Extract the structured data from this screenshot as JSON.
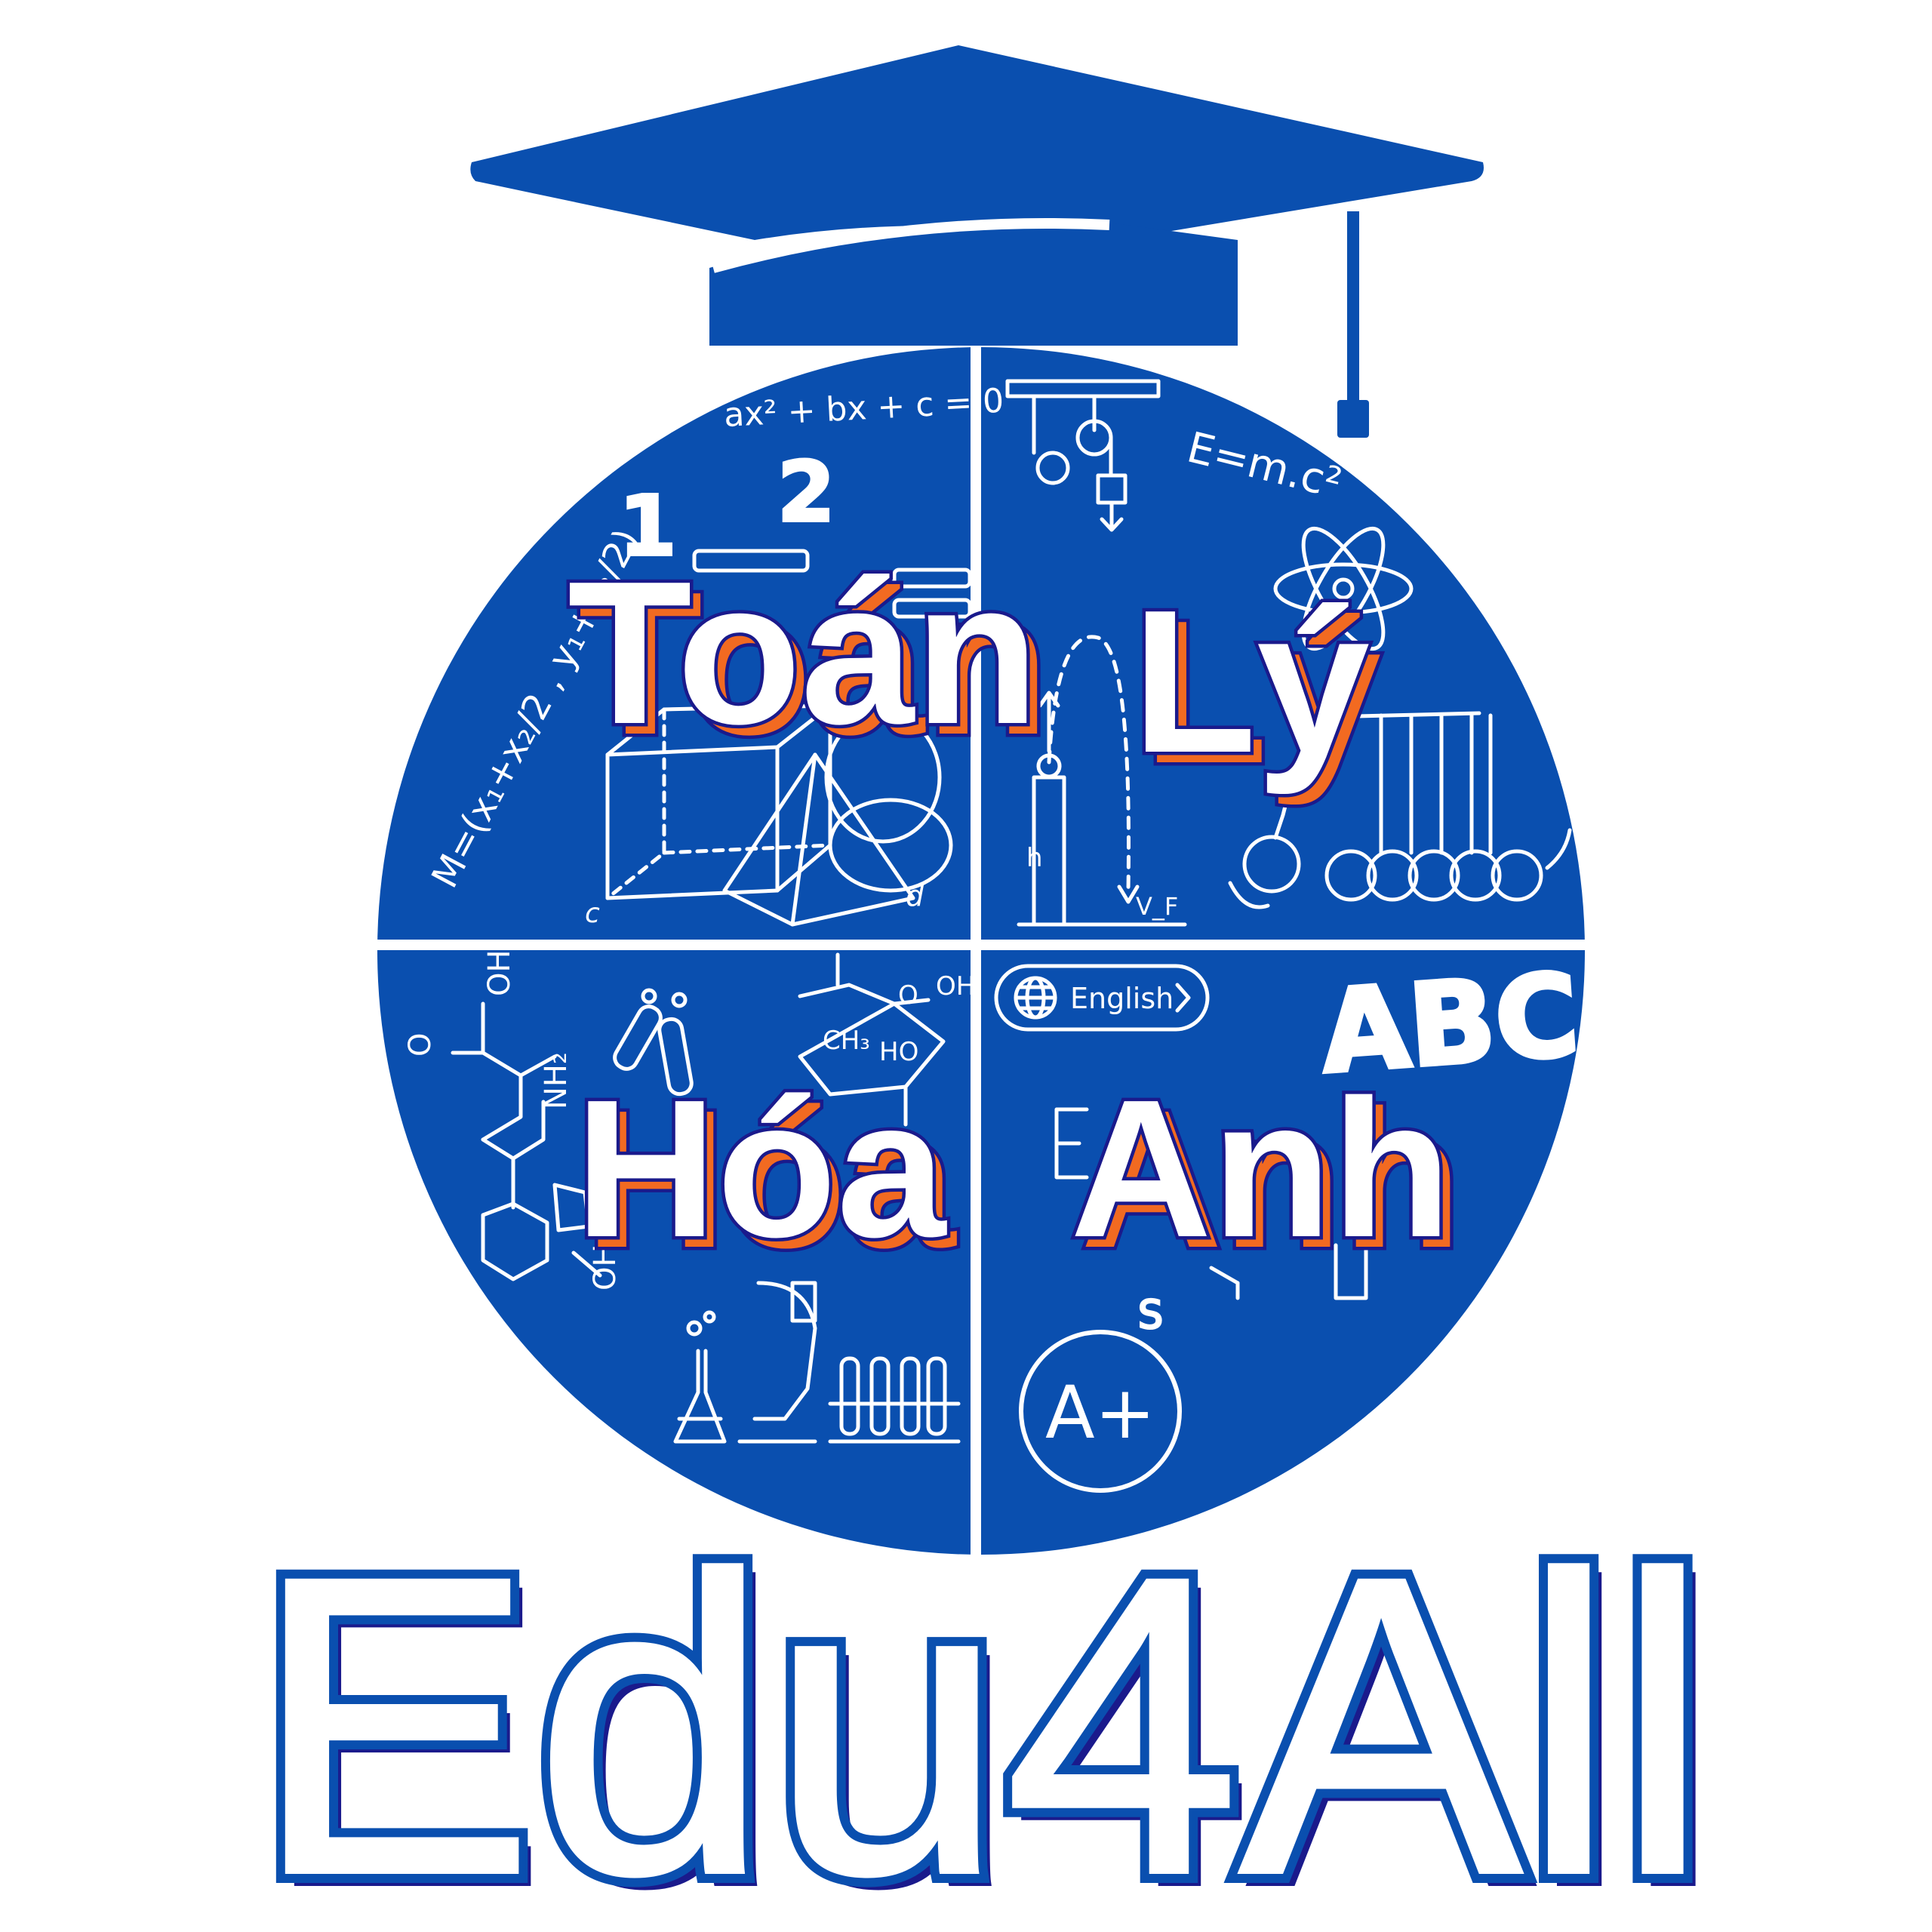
{
  "colors": {
    "brand_blue": "#0a4faf",
    "outline_navy": "#1a1a8c",
    "accent_orange": "#f26a21",
    "background": "#ffffff",
    "doodle_white": "#ffffff"
  },
  "icons": [
    "graduation-cap-icon",
    "globe-icon",
    "chevron-right-icon"
  ],
  "quadrants": {
    "math": {
      "title": "Toán",
      "formula_quadratic": "ax² + bx + c = 0",
      "formula_midpoint": "M=(x₁+x₂/2 , y₁+y₂/2)",
      "digit_one": "1",
      "digit_two": "2",
      "label_c": "c",
      "label_d": "d"
    },
    "physics": {
      "title": "Lý",
      "formula_energy": "E=m.c²",
      "label_h": "h",
      "label_vf": "V_F"
    },
    "chemistry": {
      "title": "Hóa",
      "label_oh_top": "OH",
      "label_o": "O",
      "label_nh2": "NH₂",
      "label_oh_bottom": "OH",
      "label_o_ring": "O",
      "label_oh_ring": "OH",
      "label_ch3": "CH₃",
      "label_ho": "HO"
    },
    "english": {
      "title": "Anh",
      "language_button": "English",
      "abc": "ABC",
      "grade": "A+",
      "label_s": "S"
    }
  },
  "brand": {
    "name": "Edu4All"
  }
}
